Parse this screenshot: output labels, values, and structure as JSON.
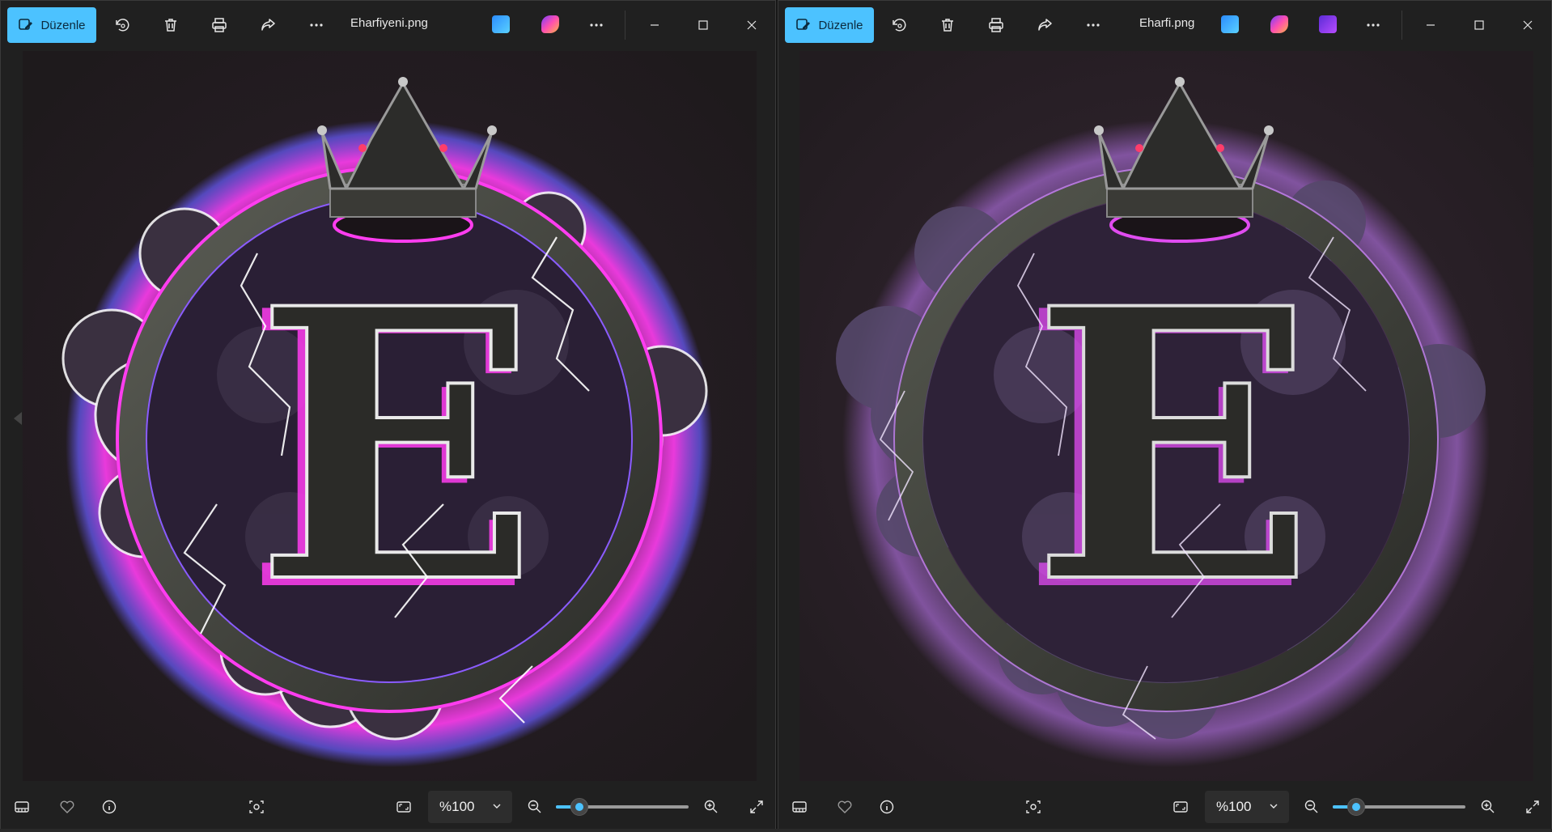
{
  "colors": {
    "accent": "#4cc2ff",
    "window_bg": "#202020",
    "neon_pink": "#ff3df0",
    "neon_violet": "#8a5cff"
  },
  "windows": [
    {
      "id": "left",
      "edit_label": "Düzenle",
      "filename": "Eharfiyeni.png",
      "zoom_value": "%100",
      "zoom_level_fraction": 0.18,
      "icons": [
        "edit-icon",
        "rotate-icon",
        "delete-icon",
        "print-icon",
        "share-icon",
        "more-icon",
        "photo-editor-app-icon",
        "designer-app-icon",
        "more-icon",
        "minimize-icon",
        "maximize-icon",
        "close-icon",
        "filmstrip-icon",
        "favorite-icon",
        "info-icon",
        "visual-search-icon",
        "fit-screen-icon",
        "chevron-down-icon",
        "zoom-out-icon",
        "zoom-in-icon",
        "fullscreen-icon"
      ]
    },
    {
      "id": "right",
      "edit_label": "Düzenle",
      "filename": "Eharfi.png",
      "zoom_value": "%100",
      "zoom_level_fraction": 0.18,
      "icons": [
        "edit-icon",
        "rotate-icon",
        "delete-icon",
        "print-icon",
        "share-icon",
        "more-icon",
        "photo-editor-app-icon",
        "designer-app-icon",
        "clipchamp-app-icon",
        "more-icon",
        "minimize-icon",
        "maximize-icon",
        "close-icon",
        "filmstrip-icon",
        "favorite-icon",
        "info-icon",
        "visual-search-icon",
        "fit-screen-icon",
        "chevron-down-icon",
        "zoom-out-icon",
        "zoom-in-icon",
        "fullscreen-icon"
      ]
    }
  ],
  "artwork": {
    "letter": "E"
  }
}
